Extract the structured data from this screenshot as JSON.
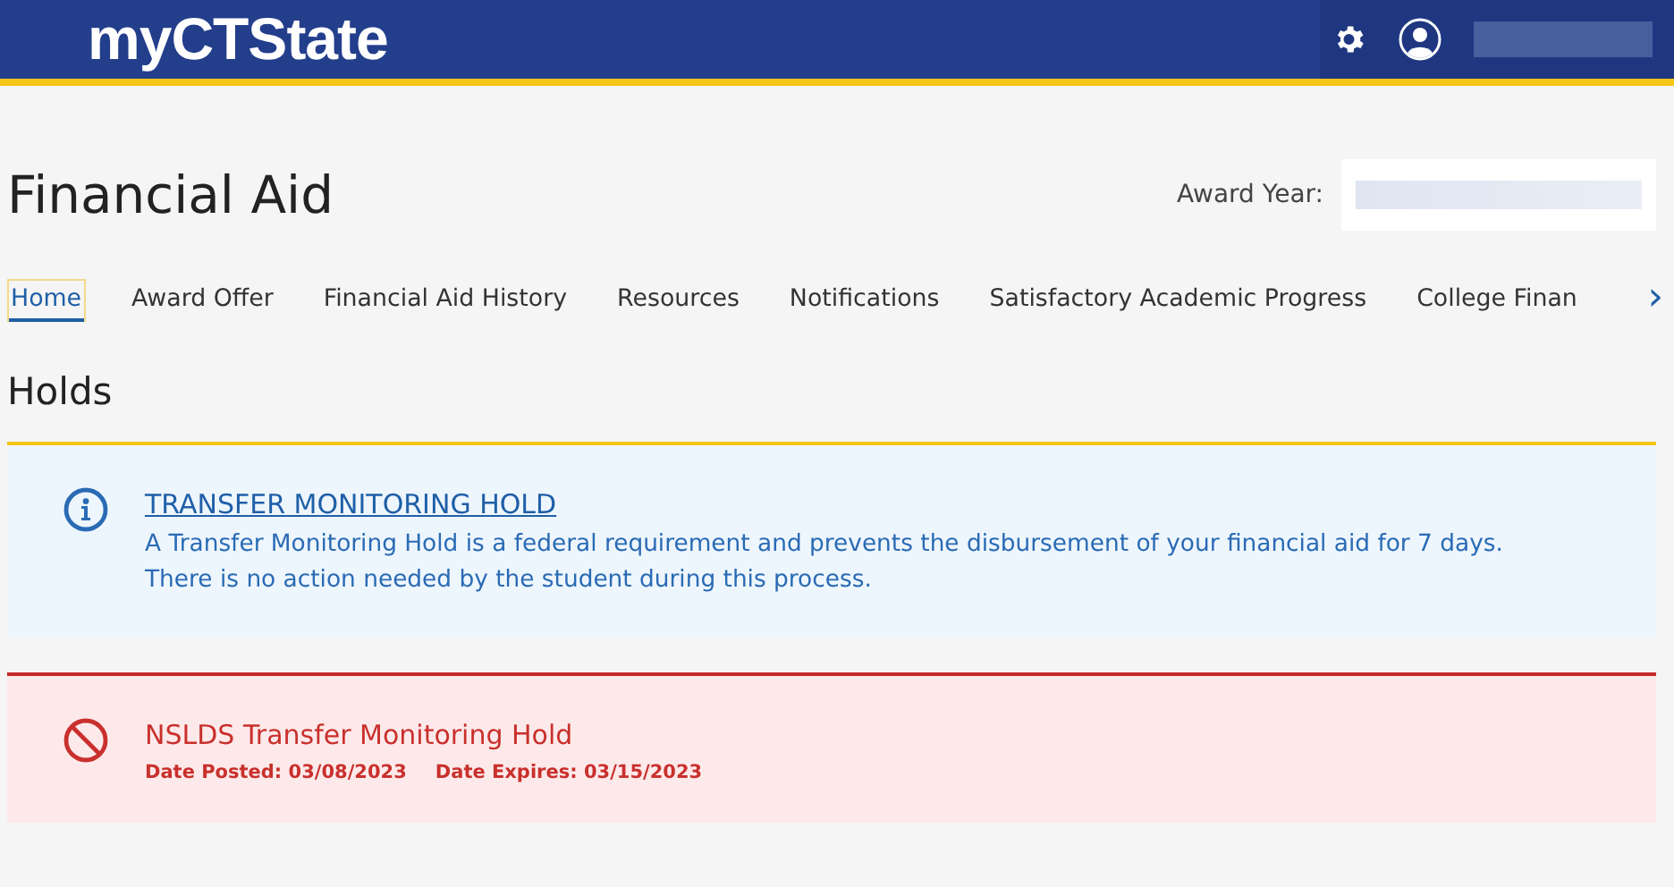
{
  "header": {
    "logo": "myCTState"
  },
  "page": {
    "title": "Financial Aid",
    "award_year_label": "Award Year:"
  },
  "tabs": [
    {
      "label": "Home",
      "selected": true
    },
    {
      "label": "Award Offer",
      "selected": false
    },
    {
      "label": "Financial Aid History",
      "selected": false
    },
    {
      "label": "Resources",
      "selected": false
    },
    {
      "label": "Notifications",
      "selected": false
    },
    {
      "label": "Satisfactory Academic Progress",
      "selected": false
    },
    {
      "label": "College Finan",
      "selected": false
    }
  ],
  "tabs_next": "›",
  "section_title": "Holds",
  "holds": [
    {
      "kind": "info",
      "title": "TRANSFER MONITORING HOLD",
      "description": "A Transfer Monitoring Hold is a federal requirement and prevents the disbursement of your financial aid for 7 days. There is no action needed by the student during this process."
    },
    {
      "kind": "error",
      "title": "NSLDS Transfer Monitoring Hold",
      "date_posted": "Date Posted: 03/08/2023",
      "date_expires": "Date Expires: 03/15/2023"
    }
  ]
}
